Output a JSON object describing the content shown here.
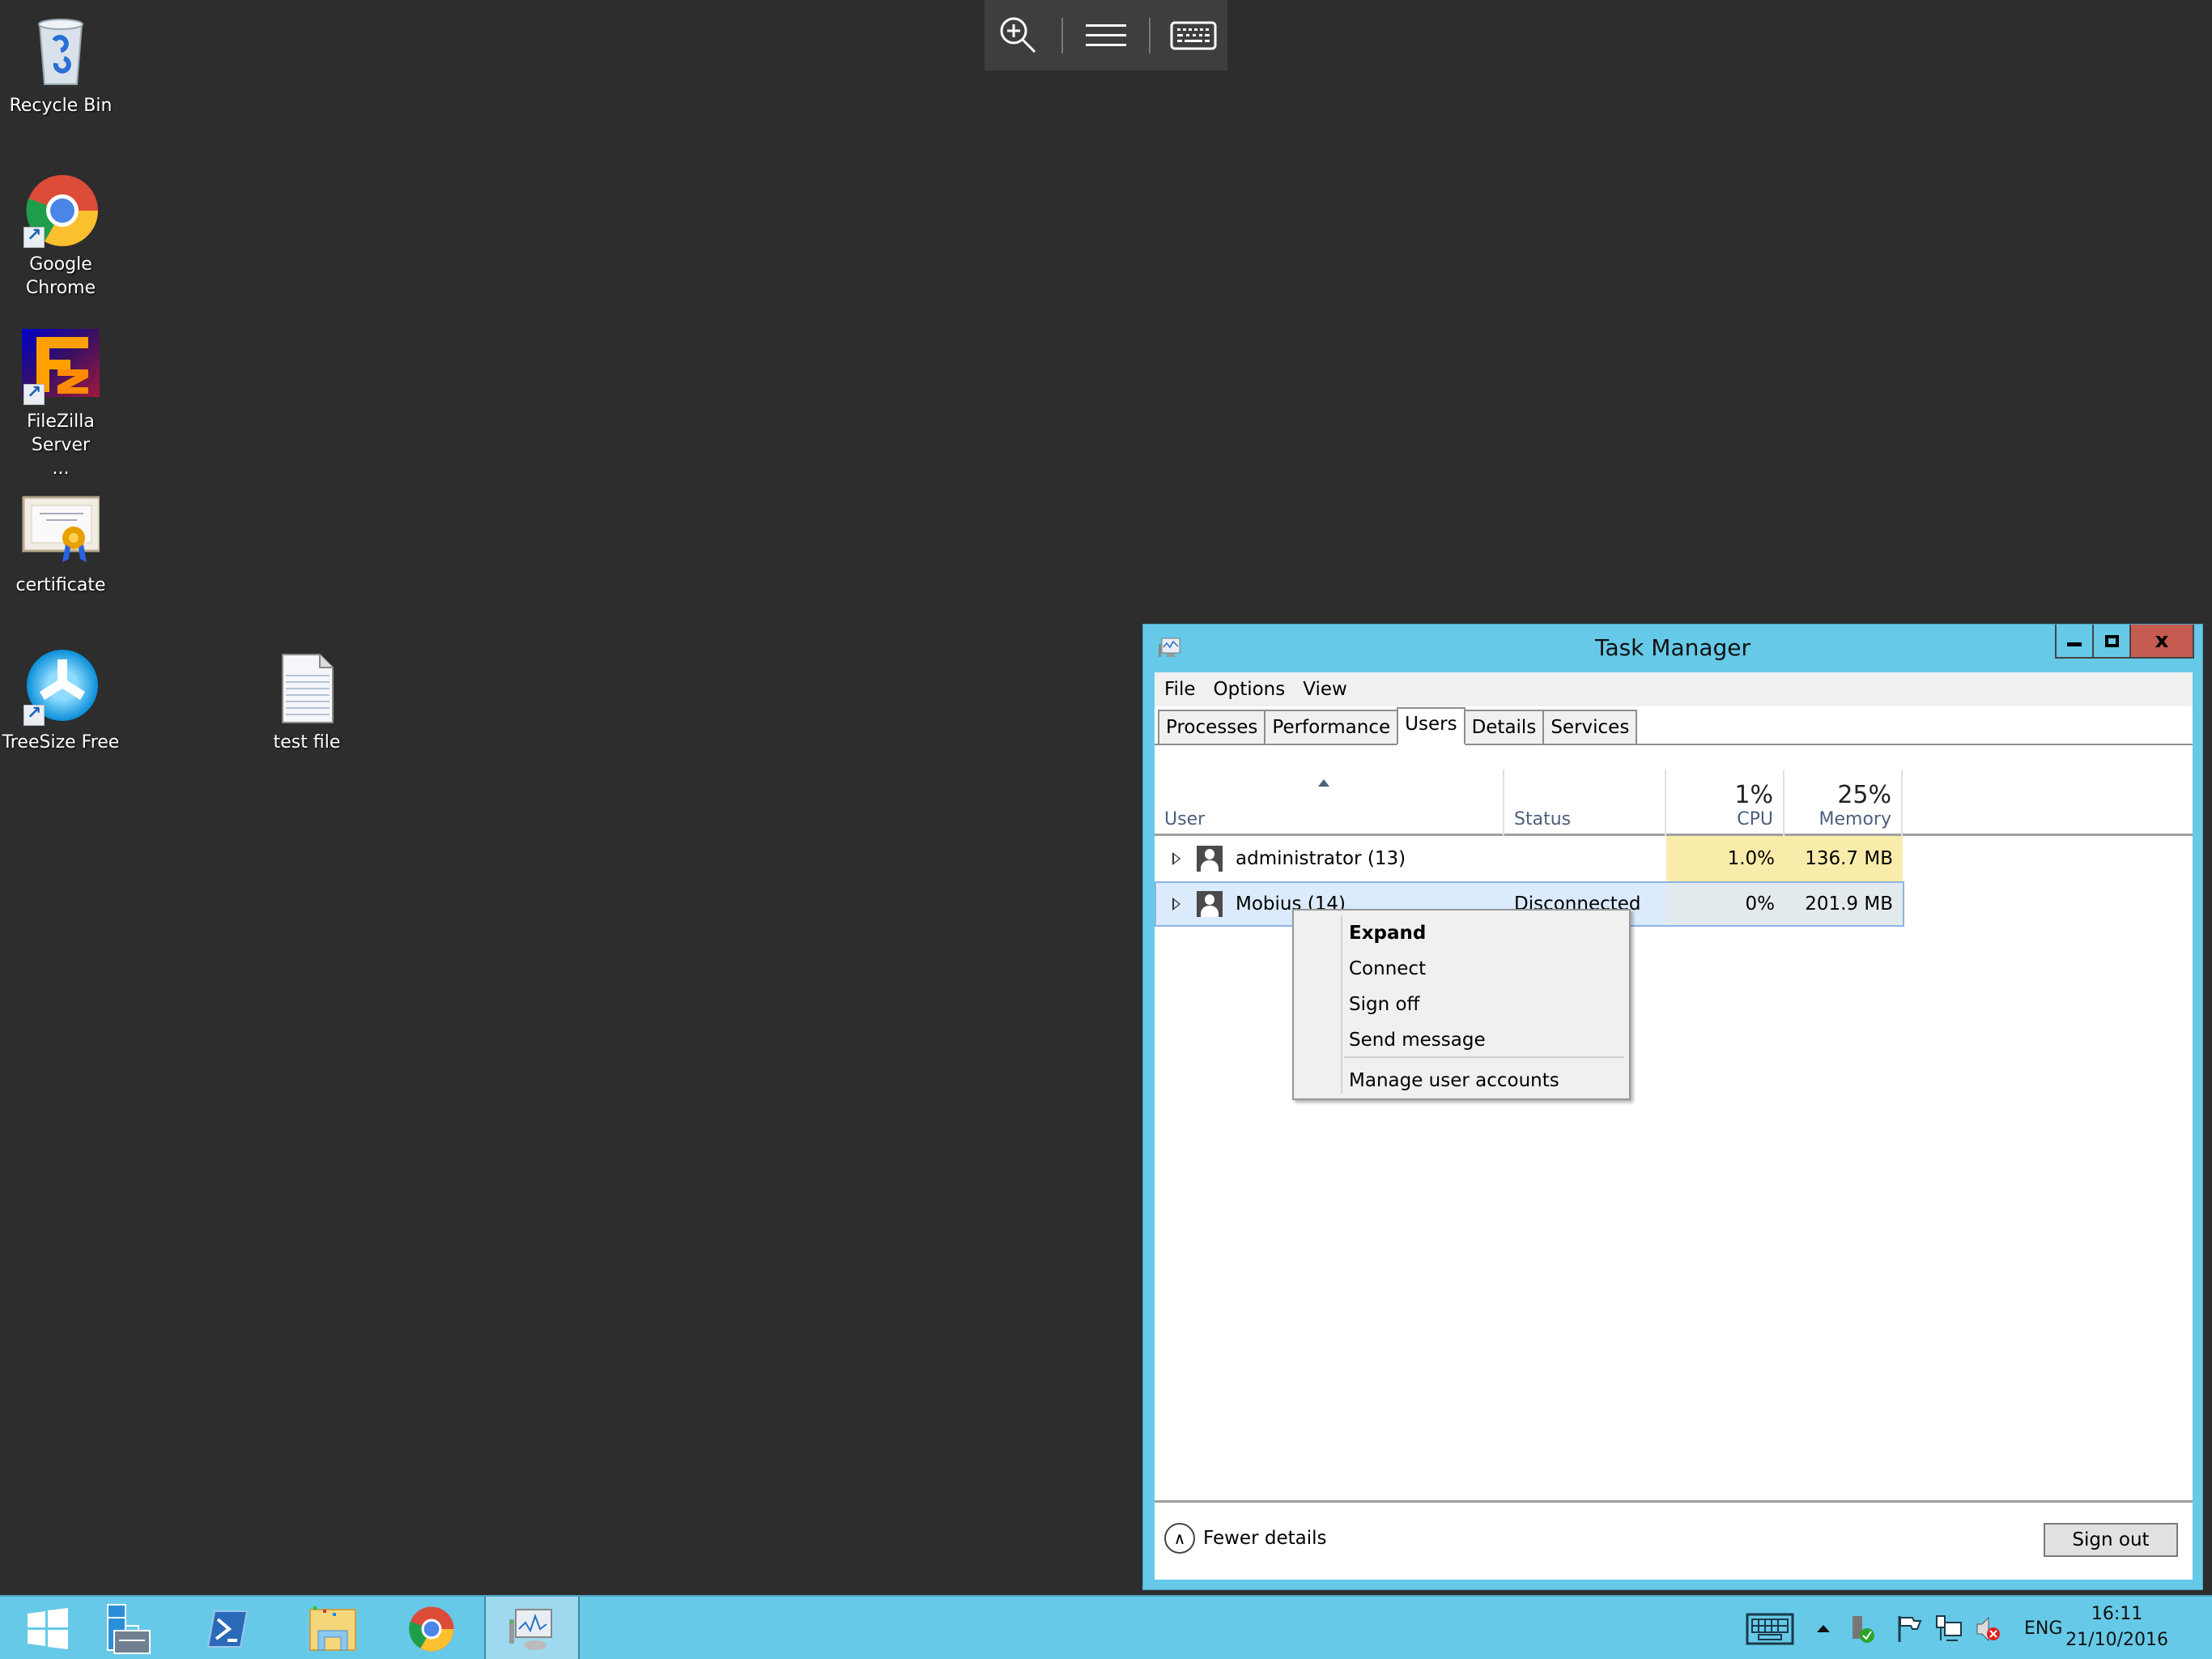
{
  "desktop": {
    "icons": [
      {
        "name": "Recycle Bin",
        "icon": "recycle-bin-icon",
        "shortcut": false
      },
      {
        "name": "Google Chrome",
        "icon": "chrome-icon",
        "shortcut": true
      },
      {
        "name": "FileZilla Server ...",
        "icon": "filezilla-icon",
        "shortcut": true
      },
      {
        "name": "certificate",
        "icon": "certificate-icon",
        "shortcut": false
      },
      {
        "name": "TreeSize Free",
        "icon": "treesize-icon",
        "shortcut": true
      },
      {
        "name": "test file",
        "icon": "text-file-icon",
        "shortcut": false
      }
    ]
  },
  "rdp_toolbar": {
    "buttons": [
      {
        "icon": "zoom-in-icon"
      },
      {
        "icon": "menu-icon"
      },
      {
        "icon": "keyboard-icon"
      }
    ]
  },
  "task_manager": {
    "title": "Task Manager",
    "window_controls": {
      "minimize": "minimize",
      "maximize": "maximize",
      "close": "x"
    },
    "menu": [
      "File",
      "Options",
      "View"
    ],
    "tabs": [
      {
        "label": "Processes",
        "active": false
      },
      {
        "label": "Performance",
        "active": false
      },
      {
        "label": "Users",
        "active": true
      },
      {
        "label": "Details",
        "active": false
      },
      {
        "label": "Services",
        "active": false
      }
    ],
    "columns": {
      "user": "User",
      "status": "Status",
      "cpu": {
        "label": "CPU",
        "total": "1%"
      },
      "memory": {
        "label": "Memory",
        "total": "25%"
      }
    },
    "rows": [
      {
        "user": "administrator (13)",
        "status": "",
        "cpu": "1.0%",
        "memory": "136.7 MB",
        "selected": false
      },
      {
        "user": "Mobius (14)",
        "status": "Disconnected",
        "cpu": "0%",
        "memory": "201.9 MB",
        "selected": true
      }
    ],
    "footer": {
      "fewer_details": "Fewer details",
      "sign_out": "Sign out"
    },
    "colors": {
      "titlebar": "#66c9e8",
      "close_button": "#c55b51",
      "heat_high": "#f9ecaa",
      "heat_low": "#e3eaed",
      "selection": "#dbeafc"
    }
  },
  "context_menu": {
    "items": [
      {
        "label": "Expand",
        "bold": true
      },
      {
        "label": "Connect",
        "bold": false
      },
      {
        "label": "Sign off",
        "bold": false
      },
      {
        "label": "Send message",
        "bold": false
      },
      {
        "label": "Manage user accounts",
        "bold": false,
        "separator_before": true
      }
    ]
  },
  "taskbar": {
    "pinned": [
      {
        "icon": "windows-start-icon",
        "active": false
      },
      {
        "icon": "server-manager-icon",
        "active": false
      },
      {
        "icon": "powershell-icon",
        "active": false
      },
      {
        "icon": "file-explorer-icon",
        "active": false
      },
      {
        "icon": "chrome-icon",
        "active": false
      },
      {
        "icon": "task-manager-icon",
        "active": true
      }
    ],
    "tray": {
      "language": "ENG",
      "time": "16:11",
      "date": "21/10/2016"
    }
  }
}
